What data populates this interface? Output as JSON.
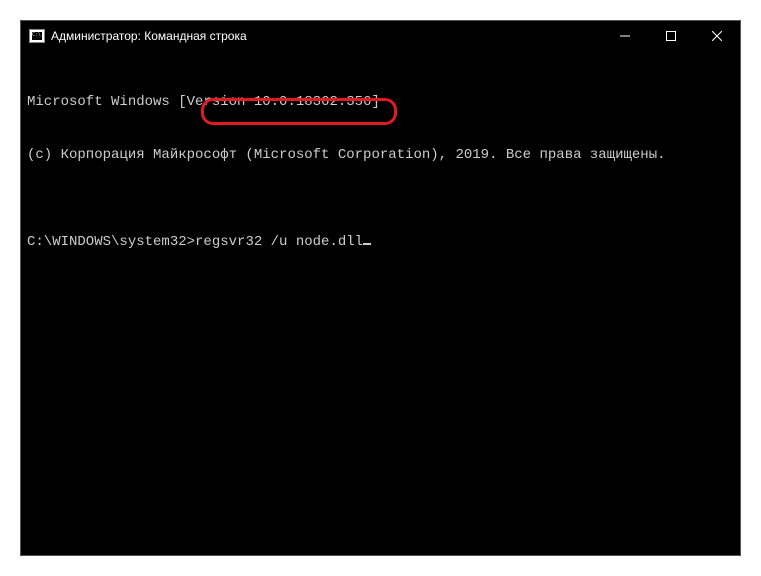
{
  "titlebar": {
    "title": "Администратор: Командная строка"
  },
  "terminal": {
    "line1": "Microsoft Windows [Version 10.0.18362.356]",
    "line2": "(c) Корпорация Майкрософт (Microsoft Corporation), 2019. Все права защищены.",
    "blank": "",
    "prompt": "C:\\WINDOWS\\system32>",
    "command": "regsvr32 /u node.dll"
  }
}
